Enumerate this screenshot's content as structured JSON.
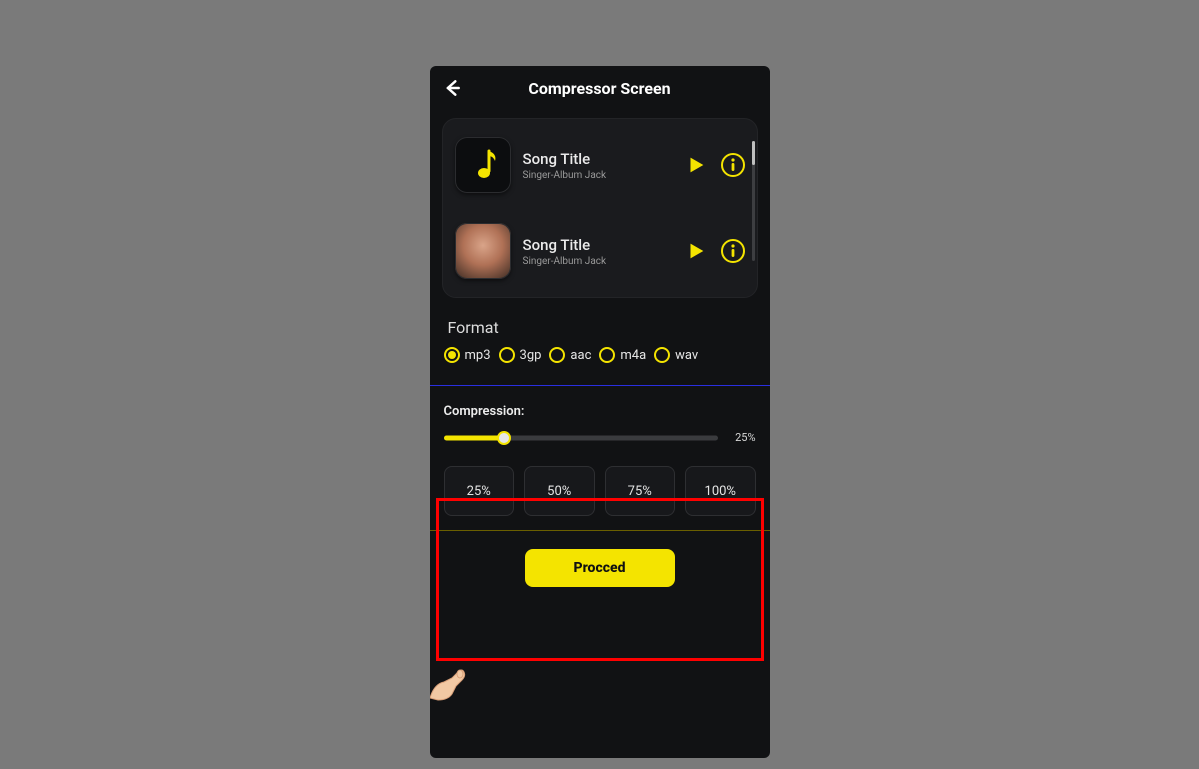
{
  "header": {
    "title": "Compressor Screen"
  },
  "songs": [
    {
      "title": "Song Title",
      "subtitle": "Singer-Album  Jack"
    },
    {
      "title": "Song Title",
      "subtitle": "Singer-Album  Jack"
    }
  ],
  "format": {
    "label": "Format",
    "options": [
      "mp3",
      "3gp",
      "aac",
      "m4a",
      "wav"
    ],
    "selected": "mp3"
  },
  "compression": {
    "label": "Compression:",
    "value_text": "25%",
    "presets": [
      "25%",
      "50%",
      "75%",
      "100%"
    ]
  },
  "proceed_label": "Procced",
  "colors": {
    "accent": "#f4e400"
  }
}
